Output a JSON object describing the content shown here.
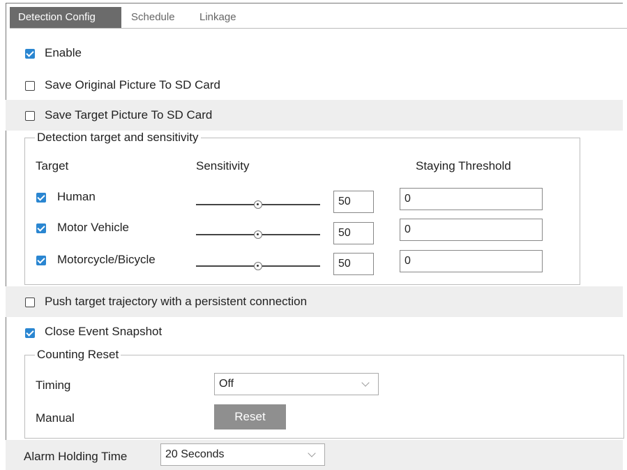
{
  "tabs": [
    {
      "label": "Detection Config",
      "active": true
    },
    {
      "label": "Schedule",
      "active": false
    },
    {
      "label": "Linkage",
      "active": false
    }
  ],
  "options": {
    "enable": {
      "label": "Enable",
      "checked": true
    },
    "save_original": {
      "label": "Save Original Picture To SD Card",
      "checked": false
    },
    "save_target": {
      "label": "Save Target Picture To SD Card",
      "checked": false
    },
    "push_trajectory": {
      "label": "Push target trajectory with a persistent connection",
      "checked": false
    },
    "close_snapshot": {
      "label": "Close Event Snapshot",
      "checked": true
    }
  },
  "detection_group": {
    "legend": "Detection target and sensitivity",
    "col_target": "Target",
    "col_sensitivity": "Sensitivity",
    "col_threshold": "Staying Threshold",
    "targets": [
      {
        "label": "Human",
        "checked": true,
        "sensitivity": "50",
        "threshold": "0"
      },
      {
        "label": "Motor Vehicle",
        "checked": true,
        "sensitivity": "50",
        "threshold": "0"
      },
      {
        "label": "Motorcycle/Bicycle",
        "checked": true,
        "sensitivity": "50",
        "threshold": "0"
      }
    ]
  },
  "counting_group": {
    "legend": "Counting Reset",
    "timing_label": "Timing",
    "timing_value": "Off",
    "manual_label": "Manual",
    "reset_button": "Reset"
  },
  "alarm": {
    "label": "Alarm Holding Time",
    "value": "20 Seconds"
  },
  "colors": {
    "accent": "#2a86d1",
    "tab_active_bg": "#6b6b6b",
    "row_shade": "#eeeeee",
    "button_bg": "#8f8f8f"
  }
}
